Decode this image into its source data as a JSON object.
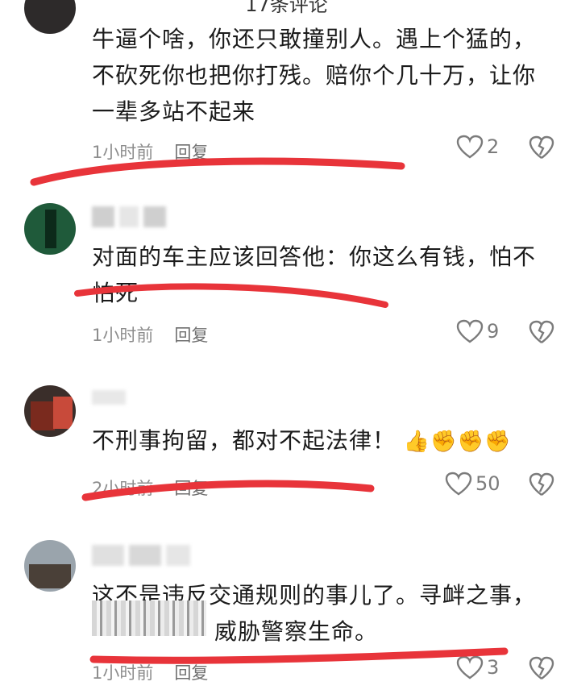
{
  "header": {
    "title": "17条评论"
  },
  "comments": [
    {
      "text_lines": [
        "牛逼个啥，你还只敢撞别人。遇上个猛的，",
        "不砍死你也把你打残。赔你个几十万，让你",
        "一辈多站不起来"
      ],
      "time": "1小时前",
      "reply": "回复",
      "likes": "2"
    },
    {
      "text_lines": [
        "对面的车主应该回答他：你这么有钱，怕不",
        "怕死"
      ],
      "time": "1小时前",
      "reply": "回复",
      "likes": "9"
    },
    {
      "text_lines": [
        "不刑事拘留，都对不起法律！"
      ],
      "emojis": "👍✊✊✊",
      "time": "2小时前",
      "reply": "回复",
      "likes": "50"
    },
    {
      "text_lines": [
        "这不是违反交通规则的事儿了。寻衅之事，",
        "威胁警察生命。"
      ],
      "time": "1小时前",
      "reply": "回复",
      "likes": "3"
    }
  ],
  "colors": {
    "annotation_red": "#e8343a",
    "meta_gray": "#8d8d8d"
  },
  "icons": {
    "like": "heart-outline-icon",
    "dislike": "broken-heart-icon"
  }
}
